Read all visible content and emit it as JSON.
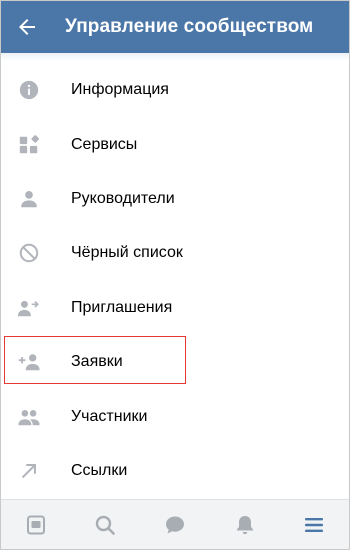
{
  "header": {
    "title": "Управление сообществом",
    "back_icon": "arrow-left-icon"
  },
  "menu": {
    "items": [
      {
        "label": "Информация",
        "icon": "info-icon"
      },
      {
        "label": "Сервисы",
        "icon": "services-icon"
      },
      {
        "label": "Руководители",
        "icon": "person-icon"
      },
      {
        "label": "Чёрный список",
        "icon": "block-icon"
      },
      {
        "label": "Приглашения",
        "icon": "person-arrow-icon"
      },
      {
        "label": "Заявки",
        "icon": "person-add-icon"
      },
      {
        "label": "Участники",
        "icon": "people-icon"
      },
      {
        "label": "Ссылки",
        "icon": "link-arrow-icon"
      }
    ],
    "highlighted_item": "Заявки"
  },
  "tabbar": {
    "tabs": [
      {
        "icon": "news-icon",
        "active": false
      },
      {
        "icon": "search-icon",
        "active": false
      },
      {
        "icon": "messages-icon",
        "active": false
      },
      {
        "icon": "notifications-icon",
        "active": false
      },
      {
        "icon": "menu-icon",
        "active": true
      }
    ]
  },
  "colors": {
    "header_bg": "#4a76a8",
    "icon_gray": "#b1b5bb",
    "active_blue": "#4a76a8",
    "tab_gray": "#a8adb4",
    "highlight_red": "#e53935"
  }
}
